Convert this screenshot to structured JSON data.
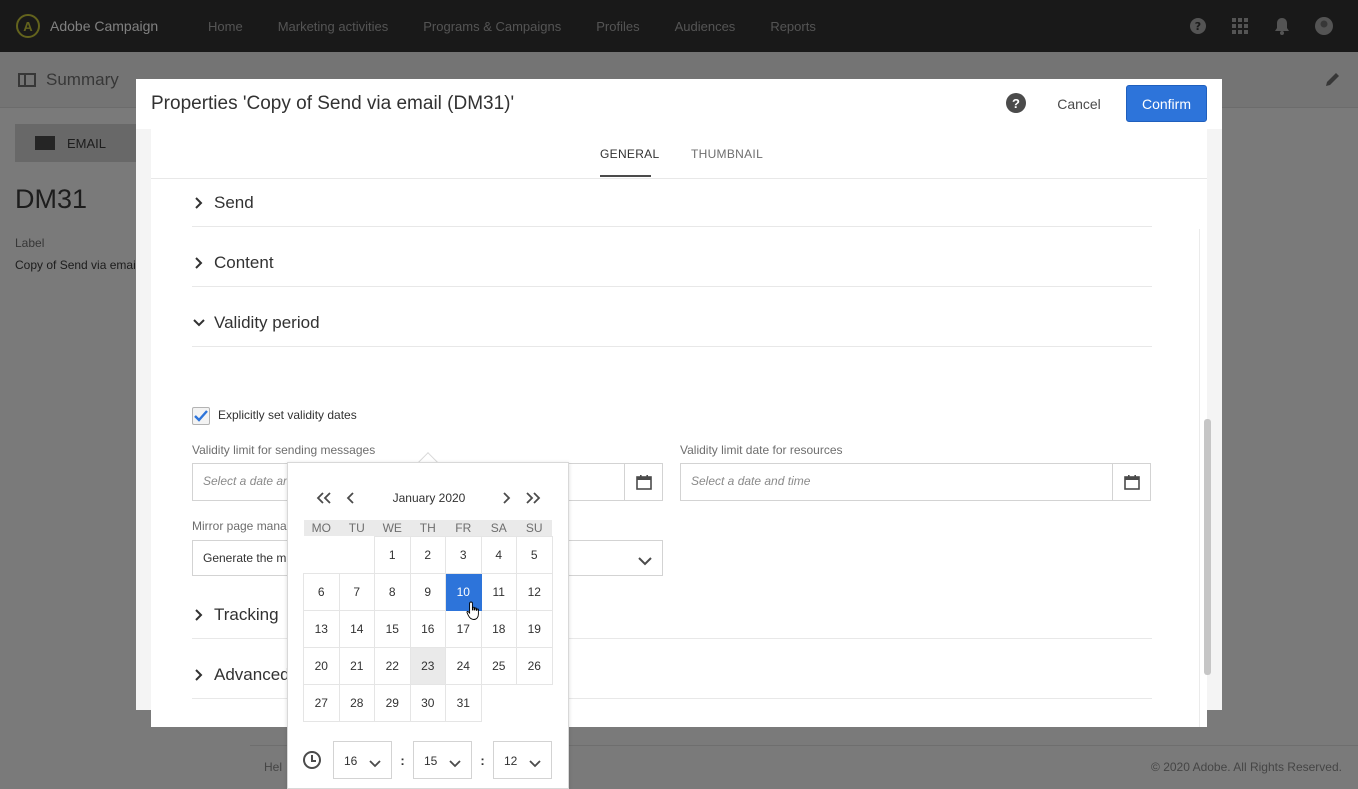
{
  "app": {
    "name": "Adobe Campaign"
  },
  "nav": [
    "Home",
    "Marketing activities",
    "Programs & Campaigns",
    "Profiles",
    "Audiences",
    "Reports"
  ],
  "background": {
    "summary_label": "Summary",
    "email_tab": "EMAIL",
    "delivery_code": "DM31",
    "label_caption": "Label",
    "label_value": "Copy of Send via email",
    "footer_help": "Hel",
    "copyright": "© 2020 Adobe. All Rights Reserved."
  },
  "dialog": {
    "title": "Properties 'Copy of Send via email (DM31)'",
    "cancel": "Cancel",
    "confirm": "Confirm",
    "tabs": [
      "GENERAL",
      "THUMBNAIL"
    ],
    "active_tab": "GENERAL",
    "sections": {
      "send": "Send",
      "content": "Content",
      "validity": "Validity period",
      "tracking": "Tracking",
      "advanced": "Advanced"
    },
    "checkbox_label": "Explicitly set validity dates",
    "checkbox_checked": true,
    "field_sending_label": "Validity limit for sending messages",
    "field_resources_label": "Validity limit date for resources",
    "date_placeholder": "Select a date and time",
    "mirror_label": "Mirror page mana",
    "mirror_value": "Generate the m"
  },
  "datepicker": {
    "month_label": "January 2020",
    "weekdays": [
      "MO",
      "TU",
      "WE",
      "TH",
      "FR",
      "SA",
      "SU"
    ],
    "weeks": [
      [
        "",
        "",
        "1",
        "2",
        "3",
        "4",
        "5"
      ],
      [
        "6",
        "7",
        "8",
        "9",
        "10",
        "11",
        "12"
      ],
      [
        "13",
        "14",
        "15",
        "16",
        "17",
        "18",
        "19"
      ],
      [
        "20",
        "21",
        "22",
        "23",
        "24",
        "25",
        "26"
      ],
      [
        "27",
        "28",
        "29",
        "30",
        "31",
        "",
        ""
      ]
    ],
    "selected_day": "10",
    "today": "23",
    "time": {
      "hours": "16",
      "minutes": "15",
      "seconds": "12"
    }
  },
  "colors": {
    "accent": "#2d74da",
    "topbar": "#323232"
  }
}
